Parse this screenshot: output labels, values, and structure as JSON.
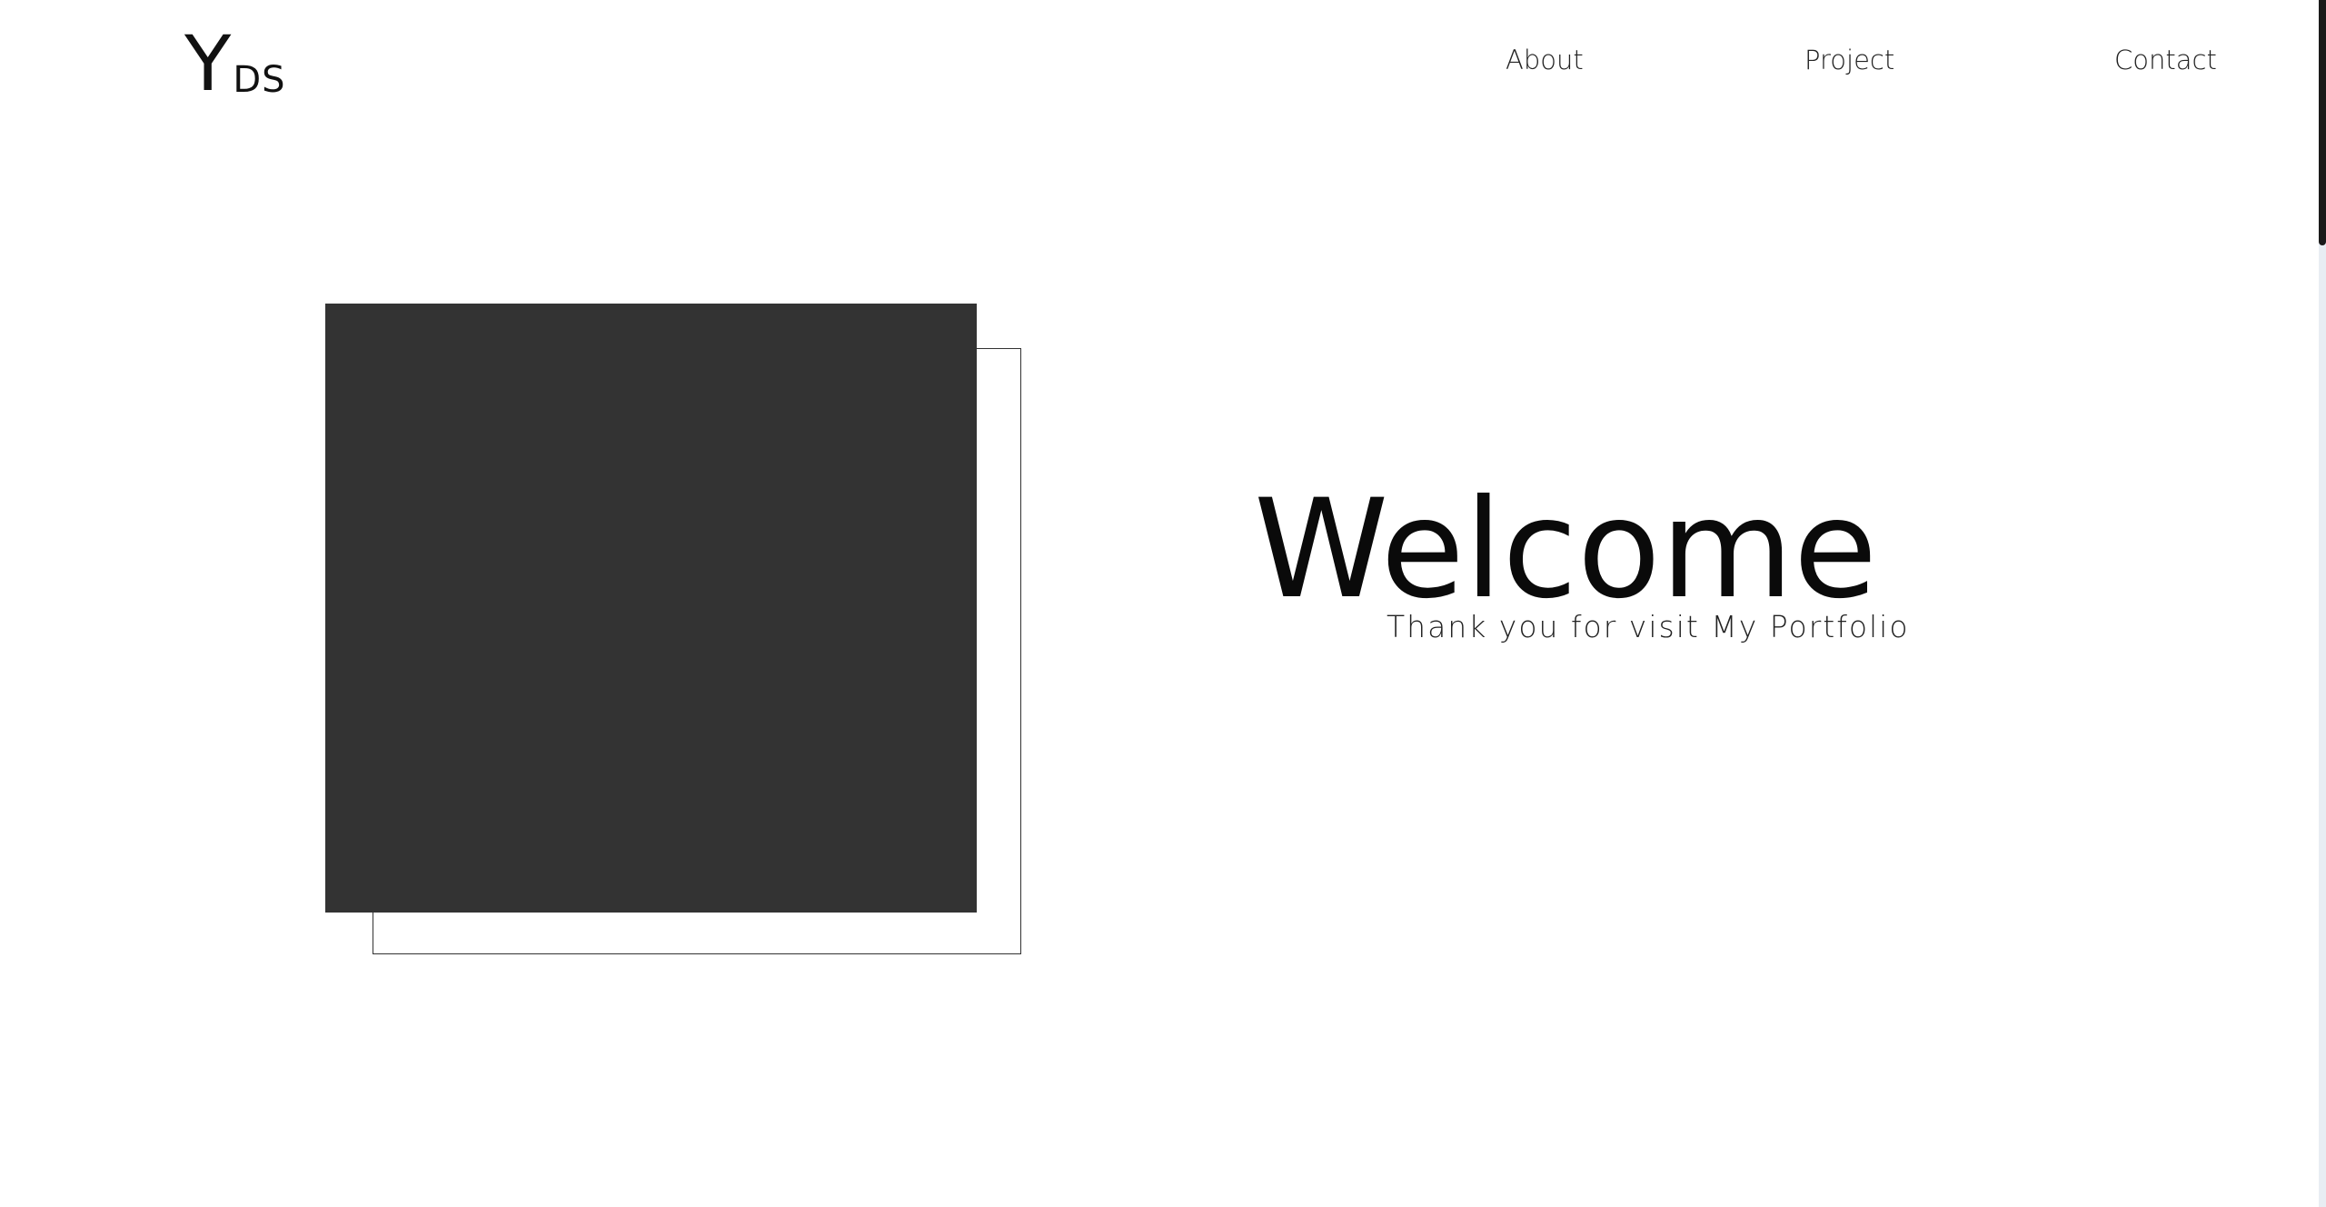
{
  "header": {
    "logo_big": "Y",
    "logo_small": "DS"
  },
  "nav": {
    "items": [
      {
        "label": "About"
      },
      {
        "label": "Project"
      },
      {
        "label": "Contact"
      }
    ]
  },
  "hero": {
    "title": "Welcome",
    "subtitle": "Thank you for visit My Portfolio"
  },
  "colors": {
    "background": "#ffffff",
    "dark_square": "#333333",
    "text": "#0a0a0a",
    "scrollbar_track": "#e8edf3",
    "scrollbar_thumb": "#1a1a1a"
  }
}
